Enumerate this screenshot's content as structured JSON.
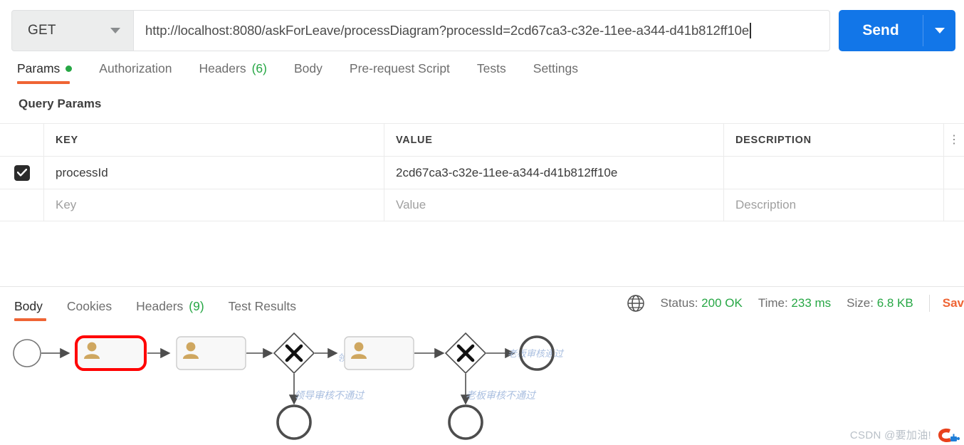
{
  "request": {
    "method": "GET",
    "method_caret_icon": "chevron-down-icon",
    "url": "http://localhost:8080/askForLeave/processDiagram?processId=2cd67ca3-c32e-11ee-a344-d41b812ff10e",
    "send_label": "Send",
    "send_caret_icon": "chevron-down-icon",
    "accent_blue": "#1276e8"
  },
  "request_tabs": [
    {
      "label": "Params",
      "badge": "",
      "active": true,
      "dot": true
    },
    {
      "label": "Authorization",
      "badge": "",
      "active": false,
      "dot": false
    },
    {
      "label": "Headers",
      "badge": "(6)",
      "active": false,
      "dot": false
    },
    {
      "label": "Body",
      "badge": "",
      "active": false,
      "dot": false
    },
    {
      "label": "Pre-request Script",
      "badge": "",
      "active": false,
      "dot": false
    },
    {
      "label": "Tests",
      "badge": "",
      "active": false,
      "dot": false
    },
    {
      "label": "Settings",
      "badge": "",
      "active": false,
      "dot": false
    }
  ],
  "query_params": {
    "section_title": "Query Params",
    "columns": [
      "KEY",
      "VALUE",
      "DESCRIPTION"
    ],
    "rows": [
      {
        "checked": true,
        "key": "processId",
        "value": "2cd67ca3-c32e-11ee-a344-d41b812ff10e",
        "description": ""
      }
    ],
    "placeholder_row": {
      "key": "Key",
      "value": "Value",
      "description": "Description"
    },
    "row_menu_icon": "ellipsis-vertical-icon"
  },
  "response_tabs": [
    {
      "label": "Body",
      "badge": "",
      "active": true
    },
    {
      "label": "Cookies",
      "badge": "",
      "active": false
    },
    {
      "label": "Headers",
      "badge": "(9)",
      "active": false
    },
    {
      "label": "Test Results",
      "badge": "",
      "active": false
    }
  ],
  "response_meta": {
    "globe_icon": "globe-icon",
    "status_label": "Status:",
    "status_value": "200 OK",
    "time_label": "Time:",
    "time_value": "233 ms",
    "size_label": "Size:",
    "size_value": "6.8 KB",
    "save_label": "Sav",
    "ok_color": "#27a745",
    "save_color": "#ef6434"
  },
  "diagram": {
    "type": "bpmn-process-diagram",
    "highlight_color": "#ff0000",
    "stroke_color": "#4d4d4d",
    "user_icon_color": "#cfa760",
    "label_color": "#aabfe0",
    "nodes": [
      {
        "id": "start",
        "kind": "start-event",
        "label": ""
      },
      {
        "id": "task1",
        "kind": "user-task",
        "label": "",
        "highlighted": true
      },
      {
        "id": "task2",
        "kind": "user-task",
        "label": ""
      },
      {
        "id": "gw1",
        "kind": "exclusive-gateway",
        "label": ""
      },
      {
        "id": "task3",
        "kind": "user-task",
        "label": ""
      },
      {
        "id": "gw2",
        "kind": "exclusive-gateway",
        "label": ""
      },
      {
        "id": "end_ok",
        "kind": "end-event",
        "label": ""
      },
      {
        "id": "end_rej1",
        "kind": "end-event",
        "label": ""
      },
      {
        "id": "end_rej2",
        "kind": "end-event",
        "label": ""
      }
    ],
    "flow_labels": {
      "gw1_pass": "领导审核通过",
      "gw1_reject": "领导审核不通过",
      "gw2_pass": "老板审核通过",
      "gw2_reject": "老板审核不通过"
    }
  },
  "watermark": {
    "text": "CSDN @要加油!",
    "logo_icon": "csdn-logo-icon"
  }
}
